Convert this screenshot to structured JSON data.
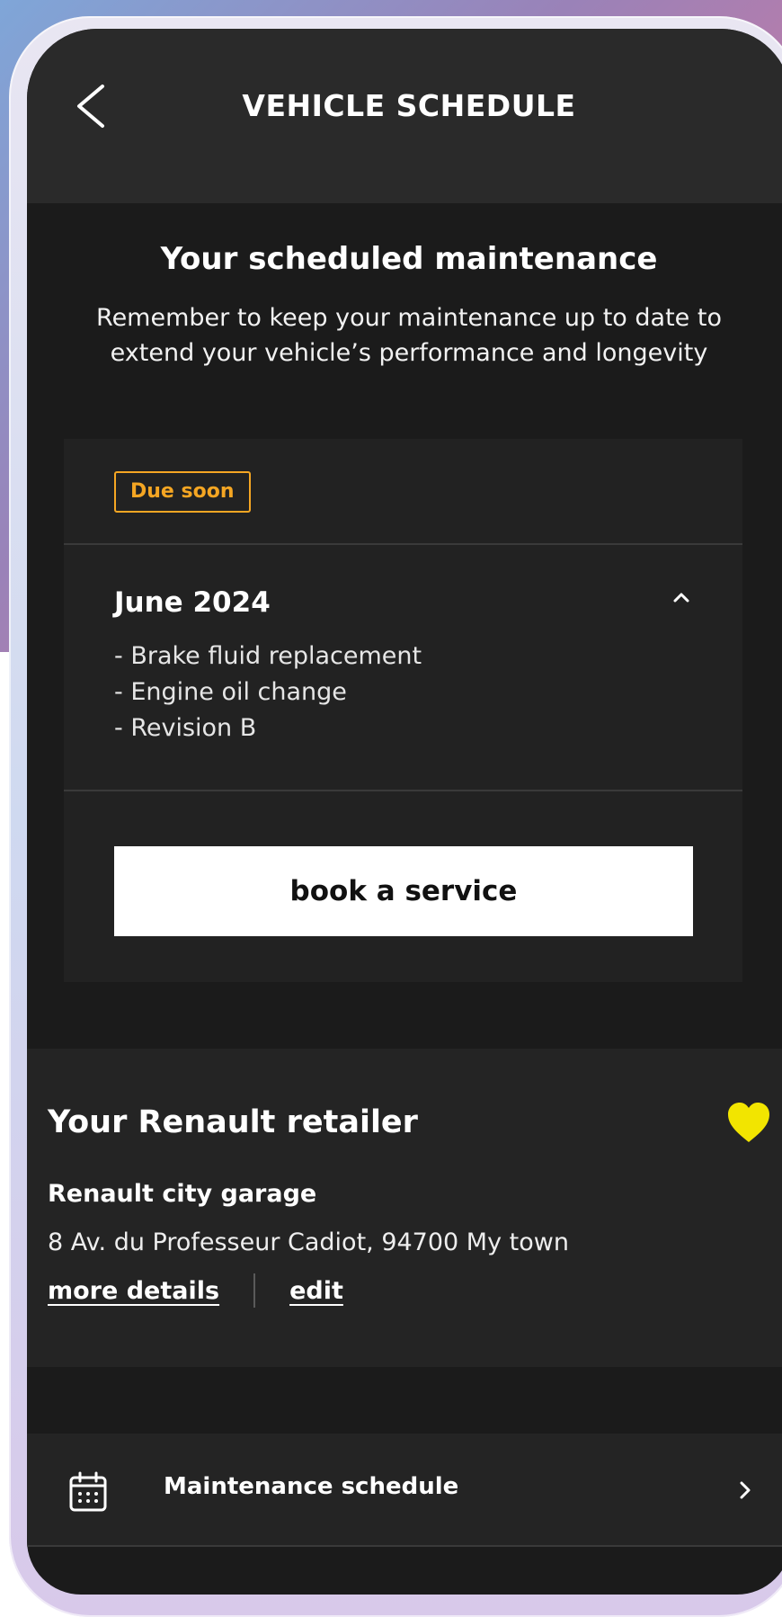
{
  "header": {
    "back_icon": "chevron-left-icon",
    "title": "VEHICLE SCHEDULE"
  },
  "maintenance": {
    "title": "Your scheduled maintenance",
    "description": "Remember to keep your maintenance up to date to extend your vehicle’s performance and longevity",
    "card": {
      "badge": "Due soon",
      "badge_color": "#f5a623",
      "month": "June 2024",
      "expand_icon": "chevron-up-icon",
      "tasks": [
        "- Brake fluid replacement",
        "- Engine oil change",
        "- Revision B"
      ],
      "button_label": "book a service"
    }
  },
  "retailer": {
    "title": "Your Renault retailer",
    "favorite_icon": "heart-icon",
    "favorite_color": "#f2e500",
    "name": "Renault city garage",
    "address": "8 Av. du Professeur Cadiot, 94700 My town",
    "more_details_label": "more details",
    "edit_label": "edit"
  },
  "menu": {
    "icon": "calendar-icon",
    "label": "Maintenance schedule",
    "arrow_icon": "chevron-right-icon"
  }
}
